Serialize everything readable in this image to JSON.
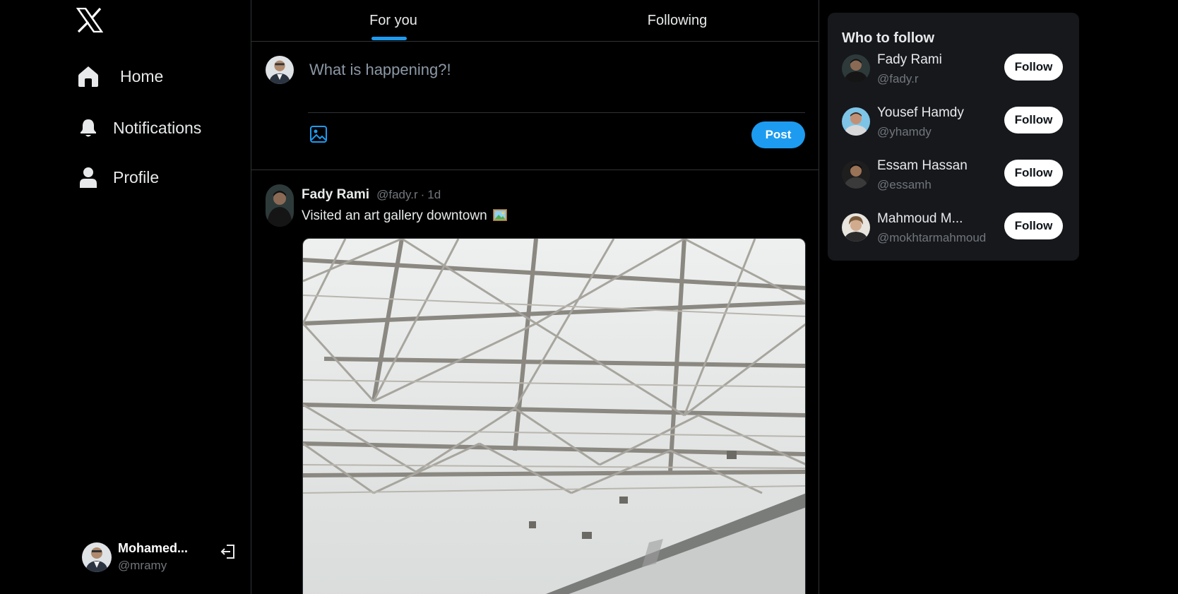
{
  "sidebar": {
    "logo": "x-logo-icon",
    "nav": [
      {
        "label": "Home",
        "icon": "home-icon"
      },
      {
        "label": "Notifications",
        "icon": "bell-icon"
      },
      {
        "label": "Profile",
        "icon": "user-icon"
      }
    ],
    "account": {
      "name": "Mohamed...",
      "handle": "@mramy",
      "logout_icon": "logout-icon"
    }
  },
  "feed": {
    "tabs": [
      {
        "label": "For you",
        "active": true
      },
      {
        "label": "Following",
        "active": false
      }
    ],
    "compose": {
      "placeholder": "What is happening?!",
      "value": "",
      "post_label": "Post",
      "media_icon": "image-icon"
    },
    "tweets": [
      {
        "name": "Fady Rami",
        "handle": "@fady.r",
        "separator": "·",
        "time": "1d",
        "text": "Visited an art gallery downtown",
        "emoji": "framed-picture-emoji",
        "image": "gallery-ceiling-photo"
      }
    ]
  },
  "who_to_follow": {
    "title": "Who to follow",
    "users": [
      {
        "name": "Fady Rami",
        "handle": "@fady.r",
        "button": "Follow"
      },
      {
        "name": "Yousef Hamdy",
        "handle": "@yhamdy",
        "button": "Follow"
      },
      {
        "name": "Essam Hassan",
        "handle": "@essamh",
        "button": "Follow"
      },
      {
        "name": "Mahmoud M...",
        "handle": "@mokhtarmahmoud",
        "button": "Follow"
      }
    ]
  },
  "colors": {
    "accent": "#1d9bf0",
    "background": "#000000",
    "panel": "#16181c",
    "muted": "#71767b"
  }
}
